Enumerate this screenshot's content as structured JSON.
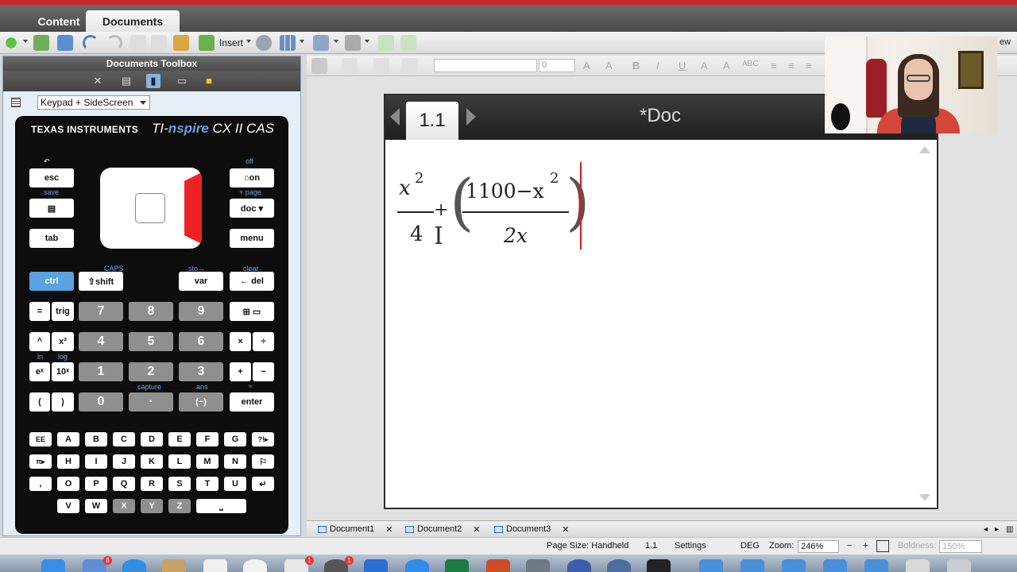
{
  "app_tabs": {
    "content": "Content",
    "documents": "Documents"
  },
  "toolbar": {
    "insert_label": "Insert"
  },
  "toolbox": {
    "title": "Documents Toolbox",
    "keypad_mode": "Keypad + SideScreen"
  },
  "calculator": {
    "brand": "TEXAS INSTRUMENTS",
    "model_prefix": "TI-",
    "model_ns": "nspire",
    "model_suffix": " CX II CAS",
    "keys": {
      "esc": "esc",
      "off": "off",
      "on": "⌂on",
      "save": "save",
      "page": "+ page",
      "doc": "doc ▾",
      "tab": "tab",
      "menu": "menu",
      "caps": "CAPS",
      "sto": "sto→",
      "clear": "clear",
      "ctrl": "ctrl",
      "shift": "⇧shift",
      "var": "var",
      "del": "← del",
      "eq": "=",
      "trig": "trig",
      "k7": "7",
      "k8": "8",
      "k9": "9",
      "pow": "^",
      "sq": "x²",
      "k4": "4",
      "k5": "5",
      "k6": "6",
      "mul": "×",
      "div": "÷",
      "ex": "eˣ",
      "tenx": "10ˣ",
      "k1": "1",
      "k2": "2",
      "k3": "3",
      "plus": "+",
      "minus": "−",
      "lparen": "(",
      "rparen": ")",
      "k0": "0",
      "dot": "·",
      "neg": "(−)",
      "enter": "enter",
      "ln": "ln",
      "log": "log",
      "capture": "capture",
      "ans": "ans",
      "approx": "≈"
    },
    "letters": {
      "row1": [
        "EE",
        "A",
        "B",
        "C",
        "D",
        "E",
        "F",
        "G",
        "?!▸"
      ],
      "row2": [
        "π▸",
        "H",
        "I",
        "J",
        "K",
        "L",
        "M",
        "N",
        "⚐"
      ],
      "row3": [
        ",",
        "O",
        "P",
        "Q",
        "R",
        "S",
        "T",
        "U",
        "↵"
      ],
      "row4": [
        "V",
        "W",
        "X",
        "Y",
        "Z",
        "⎵"
      ]
    }
  },
  "format_bar": {
    "size_value": "0"
  },
  "device": {
    "page_tab": "1.1",
    "doc_title": "*Doc"
  },
  "math": {
    "frac1_num": "x",
    "frac1_num_exp": "2",
    "frac1_den": "4",
    "plus": "+",
    "frac2_num": "1100−x",
    "frac2_num_exp": "2",
    "frac2_den": "2x"
  },
  "view_label": "ew",
  "doc_tabs": [
    {
      "label": "Document1"
    },
    {
      "label": "Document2"
    },
    {
      "label": "Document3"
    }
  ],
  "status": {
    "page_size": "Page Size: Handheld",
    "page_num": "1.1",
    "settings": "Settings",
    "angle": "DEG",
    "zoom_label": "Zoom:",
    "zoom_value": "246%",
    "boldness_label": "Boldness:",
    "boldness_value": "150%"
  },
  "dock": {
    "badge1": "8",
    "badge2": "1",
    "badge3": "1"
  }
}
